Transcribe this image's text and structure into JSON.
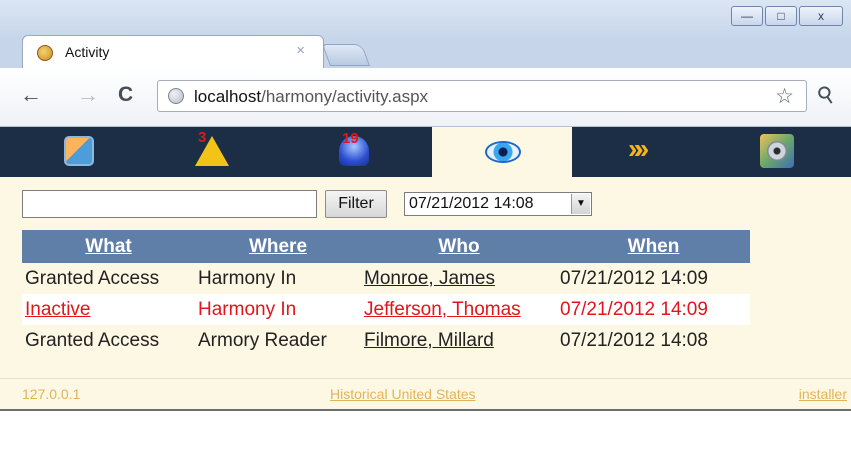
{
  "window": {
    "minimize": "—",
    "maximize": "□",
    "close": "x"
  },
  "tab": {
    "title": "Activity",
    "close": "×"
  },
  "toolbar": {
    "back": "←",
    "forward": "→",
    "reload": "C",
    "url_host": "localhost",
    "url_path": "/harmony/activity.aspx",
    "star": "☆",
    "wrench": "🔧"
  },
  "appnav": {
    "items": [
      {
        "icon": "blocks-icon",
        "badge": ""
      },
      {
        "icon": "warning-icon",
        "badge": "3"
      },
      {
        "icon": "alarm-dome-icon",
        "badge": "19"
      },
      {
        "icon": "eye-icon",
        "badge": "",
        "active": true
      },
      {
        "icon": "arrows-icon",
        "badge": ""
      },
      {
        "icon": "settings-icon",
        "badge": ""
      }
    ]
  },
  "filter": {
    "input_value": "",
    "button_label": "Filter",
    "date_value": "07/21/2012 14:08"
  },
  "table": {
    "headers": [
      "What",
      "Where",
      "Who",
      "When"
    ],
    "rows": [
      {
        "what": "Granted Access",
        "where": "Harmony In",
        "who": "Monroe, James",
        "when": "07/21/2012 14:09",
        "status": "normal"
      },
      {
        "what": "Inactive",
        "where": "Harmony In",
        "who": "Jefferson, Thomas",
        "when": "07/21/2012 14:09",
        "status": "inactive"
      },
      {
        "what": "Granted Access",
        "where": "Armory Reader",
        "who": "Filmore, Millard",
        "when": "07/21/2012 14:08",
        "status": "normal"
      }
    ]
  },
  "footer": {
    "ip": "127.0.0.1",
    "site": "Historical United States",
    "user": "installer"
  },
  "colors": {
    "nav_bg": "#1b2e46",
    "header_bg": "#5f7ea8",
    "cream": "#fdf8e4",
    "inactive_red": "#e4141a",
    "footer_text": "#e3b358"
  }
}
